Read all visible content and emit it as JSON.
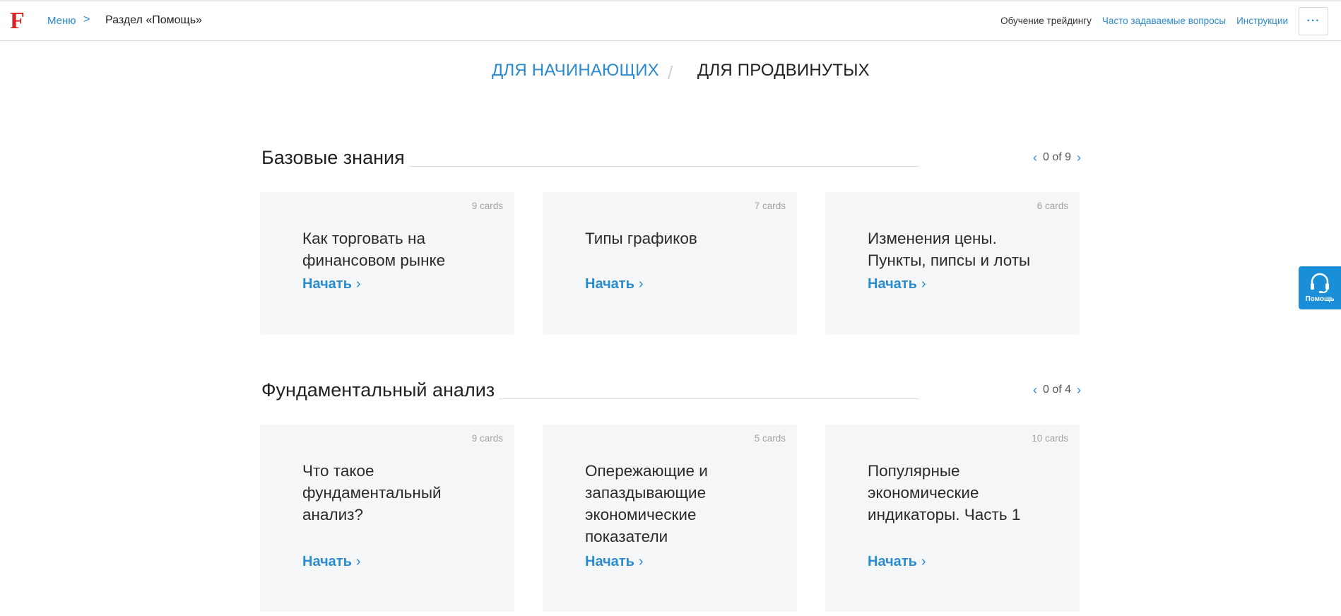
{
  "header": {
    "logo": "F",
    "breadcrumb": {
      "menu": "Меню",
      "separator": ">",
      "current": "Раздел «Помощь»"
    },
    "nav": [
      {
        "label": "Обучение трейдингу"
      },
      {
        "label": "Часто задаваемые вопросы"
      },
      {
        "label": "Инструкции"
      }
    ],
    "more": "···"
  },
  "level_tabs": {
    "beginner": "ДЛЯ НАЧИНАЮЩИХ",
    "divider": "/",
    "advanced": "ДЛЯ ПРОДВИНУТЫХ"
  },
  "sections": [
    {
      "title": "Базовые знания",
      "pager": "0 of 9",
      "cards": [
        {
          "count": "9 cards",
          "title": "Как торговать на финансовом рынке",
          "link": "Начать"
        },
        {
          "count": "7 cards",
          "title": "Типы графиков",
          "link": "Начать"
        },
        {
          "count": "6 cards",
          "title": "Изменения цены. Пункты, пипсы и лоты",
          "link": "Начать"
        }
      ]
    },
    {
      "title": "Фундаментальный анализ",
      "pager": "0 of 4",
      "cards": [
        {
          "count": "9 cards",
          "title": "Что такое фундаментальный анализ?",
          "link": "Начать"
        },
        {
          "count": "5 cards",
          "title": "Опережающие и запаздывающие экономические показатели",
          "link": "Начать"
        },
        {
          "count": "10 cards",
          "title": "Популярные экономические индикаторы. Часть 1",
          "link": "Начать"
        }
      ]
    }
  ],
  "help_widget": {
    "label": "Помощь",
    "icon": "headset-icon"
  },
  "colors": {
    "accent": "#2a8bcf",
    "logo": "#d8232a",
    "card_bg": "#f5f6f8",
    "widget": "#1a8fd8"
  }
}
